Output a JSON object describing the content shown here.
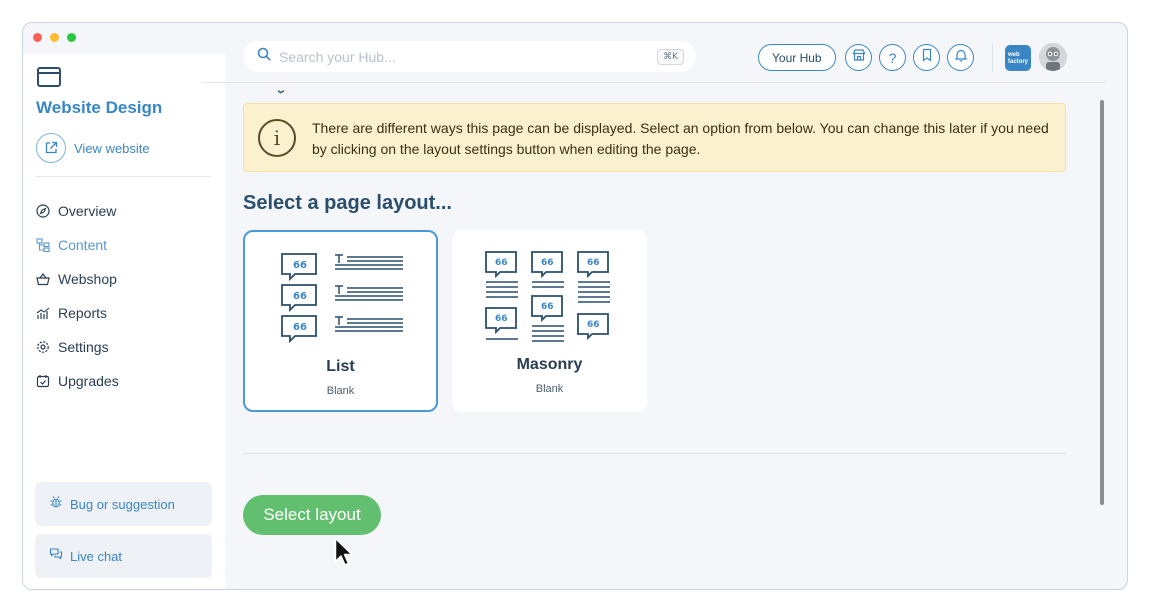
{
  "sidebar": {
    "site_title": "Website Design",
    "view_website": "View website",
    "nav": [
      {
        "label": "Overview",
        "icon": "compass-icon"
      },
      {
        "label": "Content",
        "icon": "sitemap-icon",
        "active": true
      },
      {
        "label": "Webshop",
        "icon": "basket-icon"
      },
      {
        "label": "Reports",
        "icon": "chart-icon"
      },
      {
        "label": "Settings",
        "icon": "gear-icon"
      },
      {
        "label": "Upgrades",
        "icon": "calendar-check-icon"
      }
    ],
    "bug_label": "Bug or suggestion",
    "chat_label": "Live chat"
  },
  "header": {
    "search_placeholder": "Search your Hub...",
    "shortcut": "⌘K",
    "hub_label": "Your Hub",
    "logo_text_1": "web",
    "logo_text_2": "factory"
  },
  "main": {
    "info_text": "There are different ways this page can be displayed. Select an option from below. You can change this later if you need by clicking on the layout settings button when editing the page.",
    "section_title": "Select a page layout...",
    "cards": [
      {
        "title": "List",
        "subtitle": "Blank",
        "selected": true
      },
      {
        "title": "Masonry",
        "subtitle": "Blank",
        "selected": false
      }
    ],
    "select_button": "Select layout"
  },
  "colors": {
    "accent": "#3a86c4",
    "info_bg": "#fcf1cf",
    "cta": "#62bf70",
    "heading": "#2a4e6c"
  }
}
